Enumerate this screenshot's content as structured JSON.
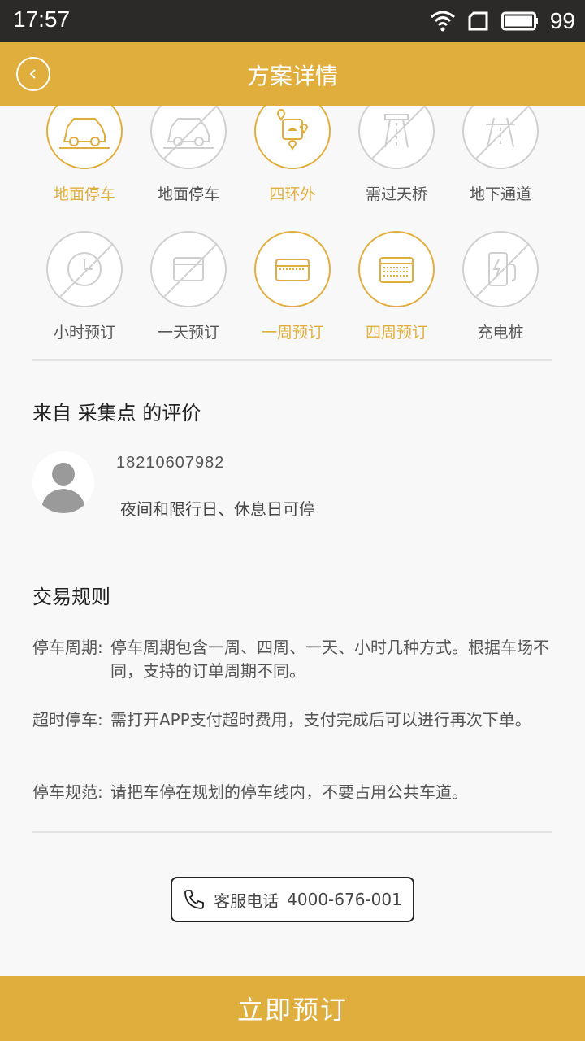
{
  "status_bar": {
    "time": "17:57",
    "battery": "99"
  },
  "app_bar": {
    "title": "方案详情"
  },
  "features_row1": [
    {
      "label": "地面停车",
      "active": true
    },
    {
      "label": "地面停车",
      "active": false
    },
    {
      "label": "四环外",
      "active": true
    },
    {
      "label": "需过天桥",
      "active": false
    },
    {
      "label": "地下通道",
      "active": false
    }
  ],
  "features_row2": [
    {
      "label": "小时预订",
      "active": false
    },
    {
      "label": "一天预订",
      "active": false
    },
    {
      "label": "一周预订",
      "active": true
    },
    {
      "label": "四周预订",
      "active": true
    },
    {
      "label": "充电桩",
      "active": false
    }
  ],
  "reviews": {
    "title": "来自 采集点 的评价",
    "user": "18210607982",
    "text": "夜间和限行日、休息日可停"
  },
  "rules": {
    "title": "交易规则",
    "items": [
      {
        "key": "停车周期:",
        "value": "停车周期包含一周、四周、一天、小时几种方式。根据车场不同，支持的订单周期不同。"
      },
      {
        "key": "超时停车:",
        "value": "需打开APP支付超时费用，支付完成后可以进行再次下单。"
      },
      {
        "key": "停车规范:",
        "value": "请把车停在规划的停车线内，不要占用公共车道。"
      }
    ]
  },
  "service": {
    "label": "客服电话",
    "phone": "4000-676-001"
  },
  "cta": {
    "label": "立即预订"
  },
  "colors": {
    "accent": "#e0ae3d",
    "inactive": "#cfcfcf",
    "status_bar": "#2b2a28"
  }
}
